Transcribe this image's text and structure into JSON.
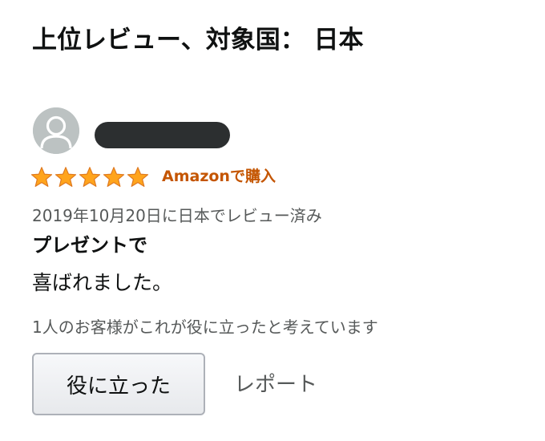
{
  "section": {
    "title": "上位レビュー、対象国： 日本"
  },
  "review": {
    "avatar_icon": "user-avatar-icon",
    "rating_stars": 5,
    "rating_max": 5,
    "star_color": "#ffa41c",
    "verified_label": "Amazonで購入",
    "verified_color": "#c45500",
    "date_text": "2019年10月20日に日本でレビュー済み",
    "title": "プレゼントで",
    "body": "喜ばれました。",
    "helpful_text": "1人のお客様がこれが役に立ったと考えています",
    "helpful_button_label": "役に立った",
    "report_label": "レポート"
  }
}
